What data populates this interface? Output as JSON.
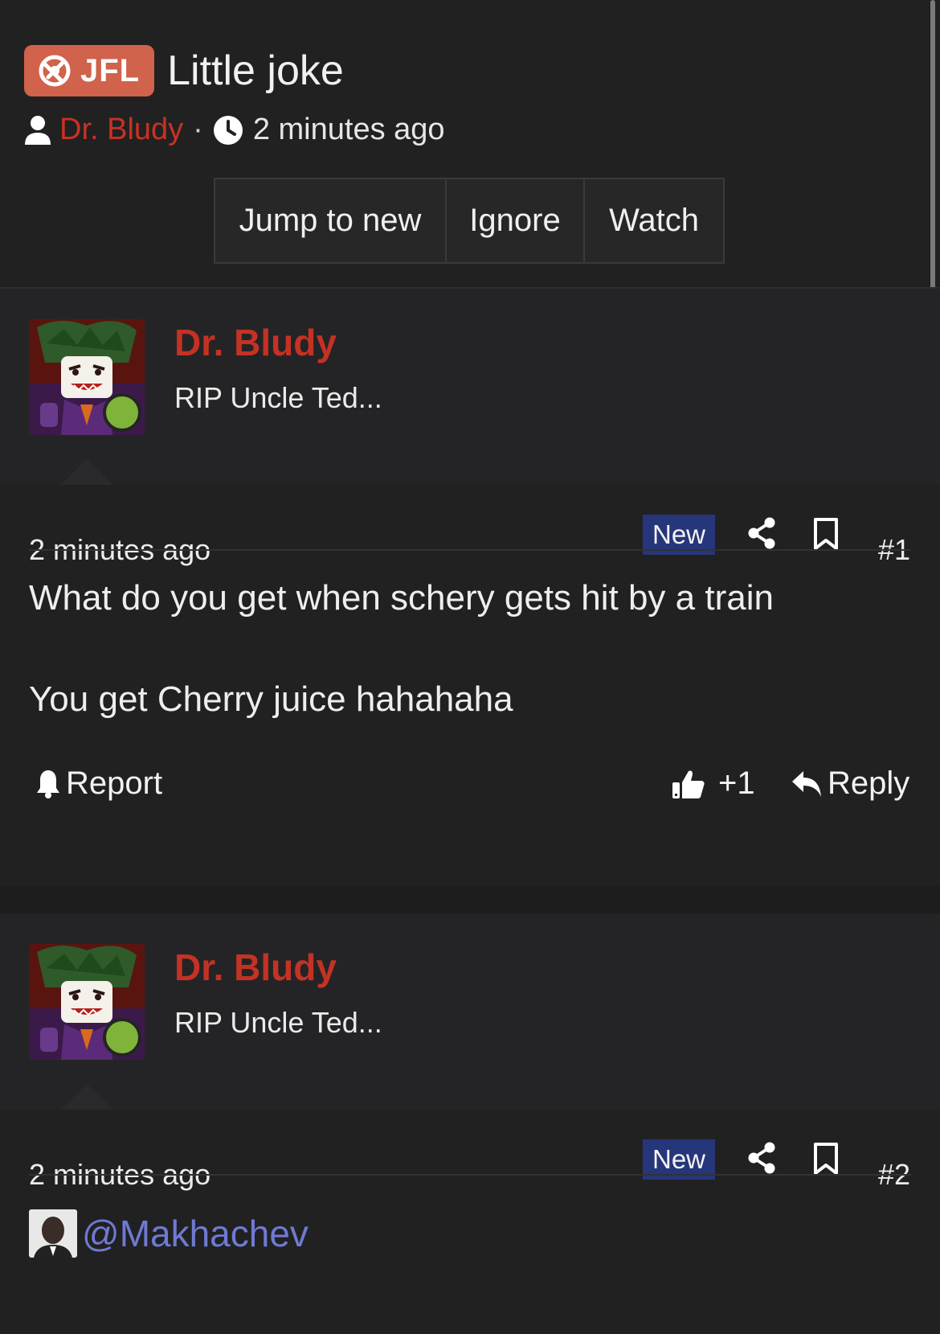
{
  "thread": {
    "prefix": "JFL",
    "title": "Little joke",
    "author": "Dr. Bludy",
    "separator": "·",
    "time": "2 minutes ago",
    "buttons": {
      "jump": "Jump to new",
      "ignore": "Ignore",
      "watch": "Watch"
    }
  },
  "posts": [
    {
      "user_name": "Dr. Bludy",
      "user_title": "RIP Uncle Ted...",
      "time": "2 minutes ago",
      "badge": "New",
      "number": "#1",
      "lines": [
        "What do you get when schery gets hit by a train",
        "You get Cherry juice hahahaha"
      ],
      "actions": {
        "report": "Report",
        "like": "+1",
        "reply": "Reply"
      }
    },
    {
      "user_name": "Dr. Bludy",
      "user_title": "RIP Uncle Ted...",
      "time": "2 minutes ago",
      "badge": "New",
      "number": "#2",
      "mention": "@Makhachev"
    }
  ],
  "colors": {
    "background": "#212122",
    "prefix_bg": "#d1624b",
    "username": "#c43224",
    "badge_new_bg": "#26367b",
    "online": "#7fb33a",
    "mention": "#6f7ad1"
  },
  "icons": [
    "brand-logo-icon",
    "user-icon",
    "clock-icon",
    "share-icon",
    "bookmark-icon",
    "bell-icon",
    "thumbs-up-icon",
    "reply-icon"
  ]
}
